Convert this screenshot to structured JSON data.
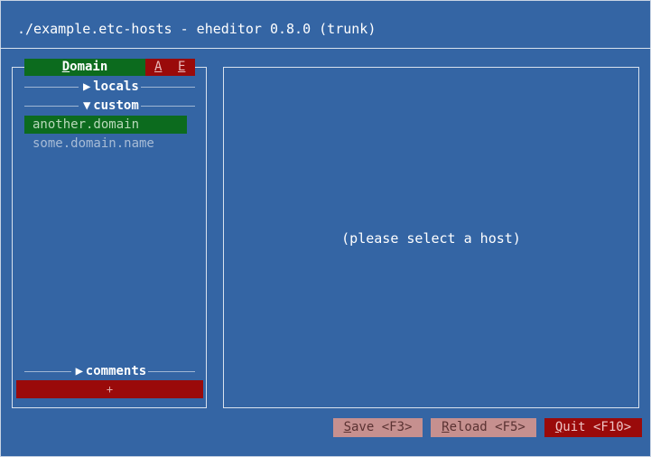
{
  "window": {
    "title": "./example.etc-hosts - eheditor 0.8.0 (trunk)"
  },
  "tabs": {
    "domain_label_first": "D",
    "domain_label_rest": "omain",
    "a_label": "A",
    "e_label": "E"
  },
  "groups": [
    {
      "arrow": "▶",
      "label": "locals",
      "expanded": false
    },
    {
      "arrow": "▼",
      "label": "custom",
      "expanded": true
    },
    {
      "arrow": "▶",
      "label": "comments",
      "expanded": false
    }
  ],
  "hosts": [
    {
      "name": "another.domain",
      "selected": true
    },
    {
      "name": "some.domain.name",
      "selected": false
    }
  ],
  "add_button": {
    "label": "+"
  },
  "detail": {
    "placeholder": "(please select a host)"
  },
  "buttons": {
    "save": {
      "hotkey": "S",
      "rest": "ave <F3>"
    },
    "reload": {
      "hotkey": "R",
      "rest": "eload <F5>"
    },
    "quit": {
      "hotkey": "Q",
      "rest": "uit <F10>"
    }
  },
  "colors": {
    "background": "#3465a4",
    "selected_bg": "#0c6b1e",
    "danger_bg": "#9a0a0a",
    "muted_button_bg": "#c6908f"
  }
}
